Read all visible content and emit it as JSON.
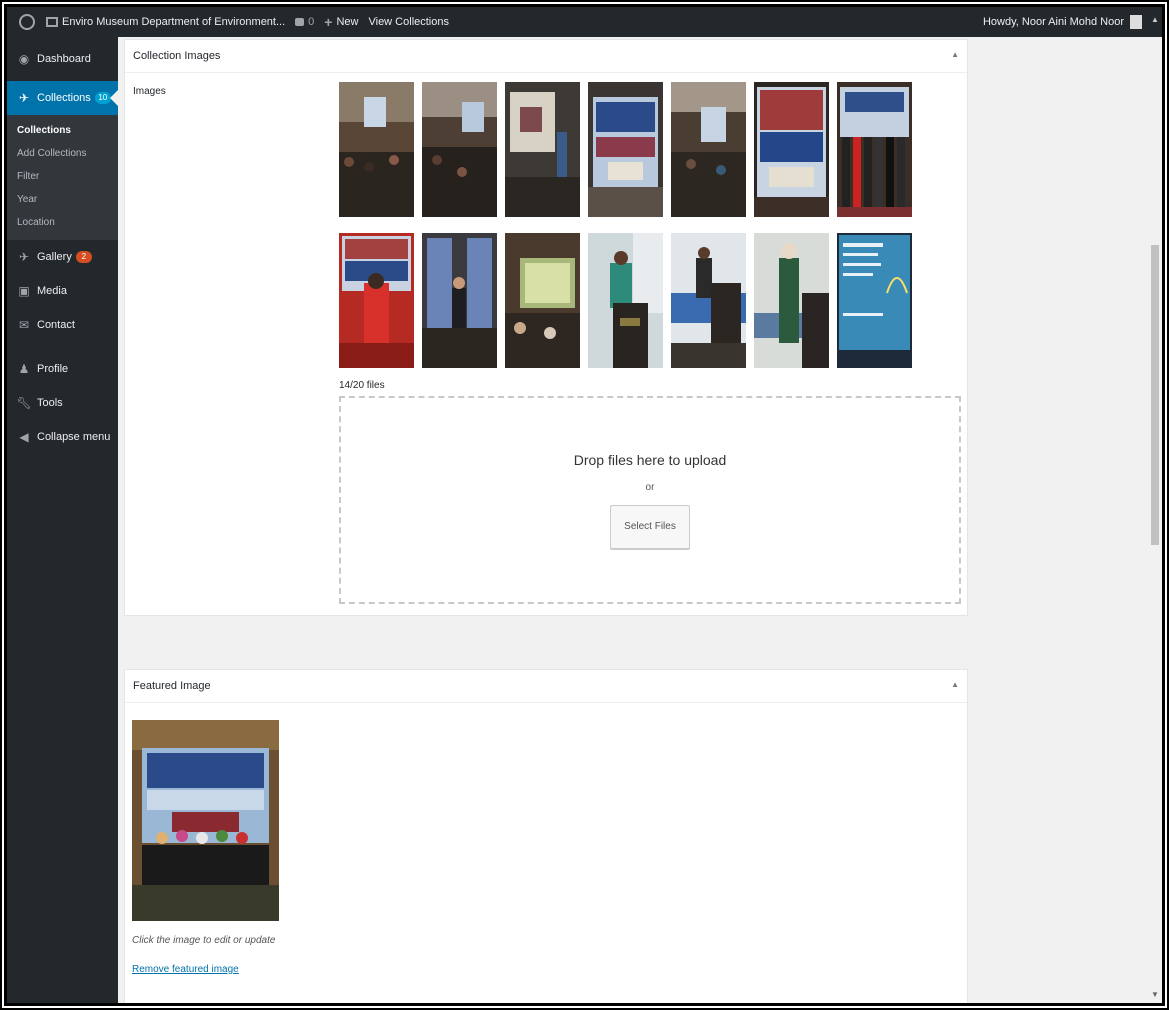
{
  "adminbar": {
    "site_name": "Enviro Museum Department of Environment...",
    "comment_count": "0",
    "new_label": "New",
    "view_label": "View Collections",
    "greeting": "Howdy, Noor Aini Mohd Noor"
  },
  "sidebar": {
    "dashboard": "Dashboard",
    "collections": "Collections",
    "collections_badge": "10",
    "submenu": [
      "Collections",
      "Add Collections",
      "Filter",
      "Year",
      "Location"
    ],
    "gallery": "Gallery",
    "gallery_badge": "2",
    "media": "Media",
    "contact": "Contact",
    "profile": "Profile",
    "tools": "Tools",
    "collapse": "Collapse menu"
  },
  "collection_images": {
    "title": "Collection Images",
    "images_label": "Images",
    "file_count": "14/20 files",
    "drop_text": "Drop files here to upload",
    "or_text": "or",
    "select_button": "Select Files"
  },
  "featured_image": {
    "title": "Featured Image",
    "caption": "Click the image to edit or update",
    "remove_link": "Remove featured image"
  },
  "colors": {
    "admin_dark": "#23282d",
    "accent_blue": "#0073aa",
    "badge_blue": "#00a0d2",
    "badge_orange": "#d54e21"
  }
}
